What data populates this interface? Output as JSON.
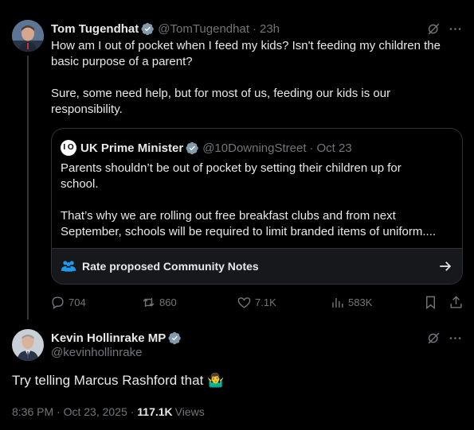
{
  "tweet1": {
    "author_name": "Tom Tugendhat",
    "handle": "@TomTugendhat",
    "separator": "·",
    "time": "23h",
    "paragraph1": "How am I out of pocket when I feed my kids? Isn't feeding my children the basic purpose of a parent?",
    "paragraph2": "Sure, some need help, but for most of us, feeding our kids is our responsibility.",
    "quote": {
      "author_name": "UK Prime Minister",
      "logo_text": "I O",
      "handle": "@10DowningStreet",
      "separator": "·",
      "date": "Oct 23",
      "paragraph1": "Parents shouldn’t be out of pocket by setting their children up for school.",
      "paragraph2": "That’s why we are rolling out free breakfast clubs and from next September, schools will be required to limit branded items of uniform....",
      "community_notes_label": "Rate proposed Community Notes"
    },
    "actions": {
      "replies": "704",
      "reposts": "860",
      "likes": "7.1K",
      "views": "583K"
    }
  },
  "tweet2": {
    "author_name": "Kevin Hollinrake MP",
    "handle": "@kevinhollinrake",
    "text": "Try telling Marcus Rashford that",
    "emoji": "🤷‍♂️",
    "timestamp": "8:36 PM · Oct 23, 2025 ·",
    "views_count": "117.1K",
    "views_label": "Views"
  },
  "colors": {
    "background": "#000000",
    "text": "#e7e9ea",
    "muted": "#71767b",
    "verified_blue": "#1d9bf0",
    "verified_gray": "#829aab",
    "border": "#2f3336"
  },
  "icons": [
    "grok-icon",
    "more-icon",
    "verified-badge-icon",
    "community-notes-icon",
    "arrow-right-icon",
    "reply-icon",
    "repost-icon",
    "like-icon",
    "views-icon",
    "bookmark-icon",
    "share-icon"
  ]
}
